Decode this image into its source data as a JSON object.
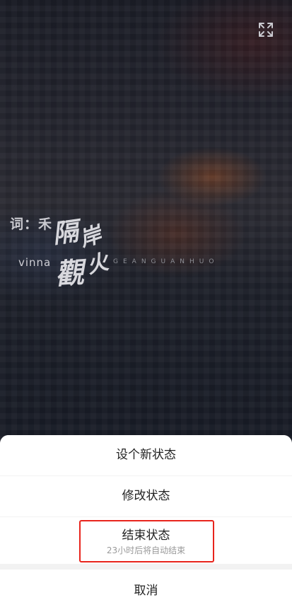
{
  "video": {
    "lyricist": "词：禾",
    "singer": "vinna",
    "title_chars": [
      "隔",
      "岸",
      "觀",
      "火"
    ],
    "pinyin": "GEANGUANHUO",
    "fullscreen_icon": "fullscreen-expand-icon"
  },
  "sheet": {
    "new_status": "设个新状态",
    "edit_status": "修改状态",
    "end_status": "结束状态",
    "end_status_hint": "23小时后将自动结束",
    "cancel": "取消"
  },
  "colors": {
    "highlight_border": "#e8241c",
    "sheet_bg": "#ffffff",
    "separator": "#f2f2f2"
  }
}
